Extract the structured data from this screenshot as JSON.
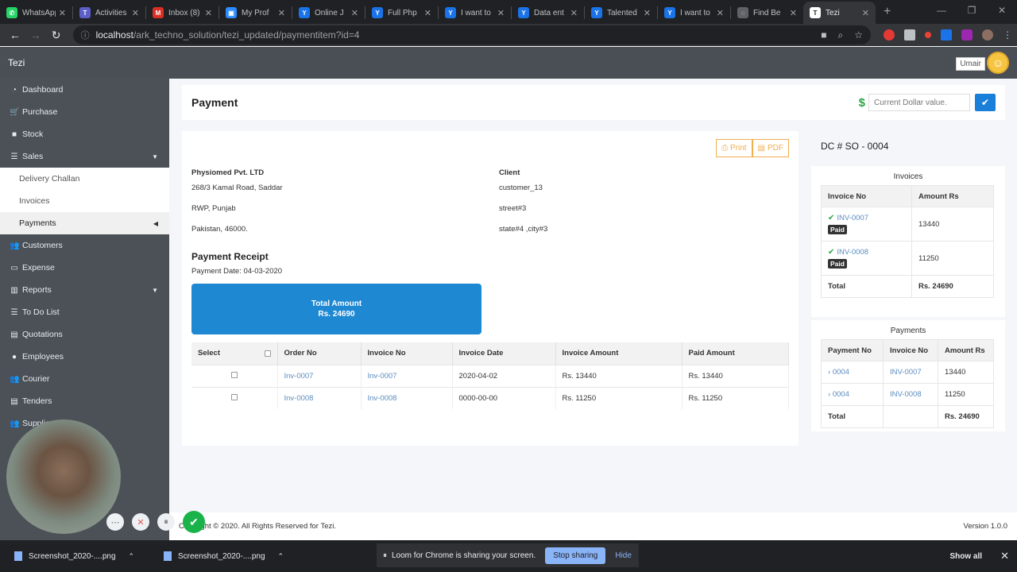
{
  "browser": {
    "tabs": [
      {
        "title": "WhatsApp",
        "icon": "whatsapp-icon",
        "color": "#25d366",
        "glyph": "✆"
      },
      {
        "title": "Activities",
        "icon": "teams-icon",
        "color": "#5b5fc7",
        "glyph": "T"
      },
      {
        "title": "Inbox (8)",
        "icon": "gmail-icon",
        "color": "#d93025",
        "glyph": "M"
      },
      {
        "title": "My Prof",
        "icon": "zoom-icon",
        "color": "#2d8cff",
        "glyph": "▣"
      },
      {
        "title": "Online J",
        "icon": "upwork-icon",
        "color": "#1a73e8",
        "glyph": "Y"
      },
      {
        "title": "Full Php",
        "icon": "upwork-icon",
        "color": "#1a73e8",
        "glyph": "Y"
      },
      {
        "title": "I want to",
        "icon": "upwork-icon",
        "color": "#1a73e8",
        "glyph": "Y"
      },
      {
        "title": "Data ent",
        "icon": "upwork-icon",
        "color": "#1a73e8",
        "glyph": "Y"
      },
      {
        "title": "Talented",
        "icon": "upwork-icon",
        "color": "#1a73e8",
        "glyph": "Y"
      },
      {
        "title": "I want to",
        "icon": "upwork-icon",
        "color": "#1a73e8",
        "glyph": "Y"
      },
      {
        "title": "Find Be",
        "icon": "loading-icon",
        "color": "#5f6368",
        "glyph": "◌"
      },
      {
        "title": "Tezi",
        "icon": "tezi-icon",
        "color": "#ffffff",
        "glyph": "T"
      }
    ],
    "url_host": "localhost",
    "url_path": "/ark_techno_solution/tezi_updated/paymentitem?id=4"
  },
  "app": {
    "brand": "Tezi",
    "user": "Umair"
  },
  "sidebar": {
    "items": [
      {
        "label": "Dashboard",
        "icon": "dashboard-icon",
        "glyph": "◔"
      },
      {
        "label": "Purchase",
        "icon": "cart-icon",
        "glyph": "🛒"
      },
      {
        "label": "Stock",
        "icon": "cube-icon",
        "glyph": "■"
      },
      {
        "label": "Sales",
        "icon": "list-icon",
        "glyph": "☰"
      }
    ],
    "sales_sub": [
      {
        "label": "Delivery Challan"
      },
      {
        "label": "Invoices"
      },
      {
        "label": "Payments"
      }
    ],
    "items2": [
      {
        "label": "Customers",
        "icon": "users-icon",
        "glyph": "👥"
      },
      {
        "label": "Expense",
        "icon": "money-icon",
        "glyph": "▭"
      },
      {
        "label": "Reports",
        "icon": "chart-icon",
        "glyph": "▥"
      },
      {
        "label": "To Do List",
        "icon": "list-icon",
        "glyph": "☰"
      },
      {
        "label": "Quotations",
        "icon": "file-icon",
        "glyph": "▤"
      },
      {
        "label": "Employees",
        "icon": "user-icon",
        "glyph": "●"
      },
      {
        "label": "Courier",
        "icon": "users-icon",
        "glyph": "👥"
      },
      {
        "label": "Tenders",
        "icon": "file-icon",
        "glyph": "▤"
      },
      {
        "label": "Suppliers",
        "icon": "users-icon",
        "glyph": "👥"
      }
    ]
  },
  "header": {
    "title": "Payment",
    "dollar_placeholder": "Current Dollar value."
  },
  "receipt": {
    "print_label": "Print",
    "pdf_label": "PDF",
    "company": {
      "name": "Physiomed Pvt. LTD",
      "line1": "268/3 Kamal Road, Saddar",
      "line2": "RWP, Punjab",
      "line3": "Pakistan, 46000."
    },
    "client": {
      "heading": "Client",
      "line1": "customer_13",
      "line2": "street#3",
      "line3": "state#4 ,city#3"
    },
    "title": "Payment Receipt",
    "date": "Payment Date: 04-03-2020",
    "total_label": "Total Amount",
    "total_value": "Rs. 24690",
    "table_headers": [
      "Select",
      "Order No",
      "Invoice No",
      "Invoice Date",
      "Invoice Amount",
      "Paid Amount"
    ],
    "rows": [
      {
        "order": "Inv-0007",
        "invoice": "Inv-0007",
        "date": "2020-04-02",
        "amount": "Rs. 13440",
        "paid": "Rs. 13440"
      },
      {
        "order": "Inv-0008",
        "invoice": "Inv-0008",
        "date": "0000-00-00",
        "amount": "Rs. 11250",
        "paid": "Rs. 11250"
      }
    ]
  },
  "right": {
    "dc_title": "DC # SO - 0004",
    "invoices_caption": "Invoices",
    "inv_headers": [
      "Invoice No",
      "Amount Rs"
    ],
    "invoices": [
      {
        "no": "INV-0007",
        "badge": "Paid",
        "amount": "13440"
      },
      {
        "no": "INV-0008",
        "badge": "Paid",
        "amount": "11250"
      }
    ],
    "inv_total_label": "Total",
    "inv_total": "Rs. 24690",
    "payments_caption": "Payments",
    "pay_headers": [
      "Payment No",
      "Invoice No",
      "Amount Rs"
    ],
    "payments": [
      {
        "payment": "0004",
        "invoice": "INV-0007",
        "amount": "13440"
      },
      {
        "payment": "0004",
        "invoice": "INV-0008",
        "amount": "11250"
      }
    ],
    "pay_total_label": "Total",
    "pay_total": "Rs. 24690"
  },
  "footer": {
    "copyright": "Copyright © 2020. All Rights Reserved for Tezi.",
    "version": "Version 1.0.0"
  },
  "shelf": {
    "downloads": [
      "Screenshot_2020-....png",
      "Screenshot_2020-....png"
    ],
    "share_text": "Loom for Chrome is sharing your screen.",
    "stop_label": "Stop sharing",
    "hide_label": "Hide",
    "show_all": "Show all"
  },
  "colors": {
    "accent": "#1e88d2",
    "sidebar": "#4b5157",
    "appbar": "#494f55",
    "print": "#f0ad4e",
    "success": "#28a745"
  }
}
